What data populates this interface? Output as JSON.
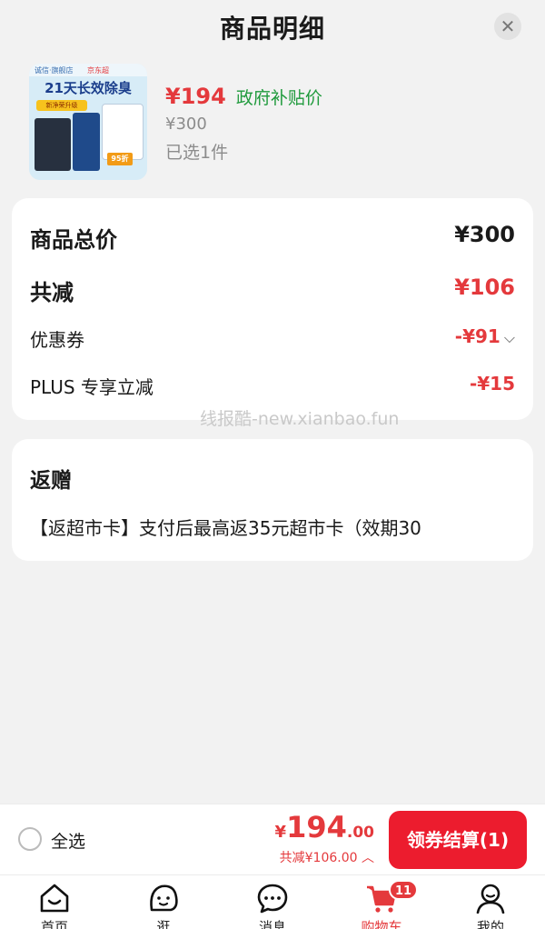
{
  "header": {
    "title": "商品明细",
    "close_icon": "close-icon"
  },
  "product": {
    "thumb": {
      "brand_left": "诚信·旗舰店",
      "brand_right": "京东超",
      "headline": "21天长效除臭",
      "tag": "新净荣升级",
      "badge": "95折"
    },
    "price": "¥194",
    "price_tag": "政府补贴价",
    "original_price": "¥300",
    "selected_count": "已选1件"
  },
  "summary": {
    "total_label": "商品总价",
    "total_value": "¥300",
    "reduce_label": "共减",
    "reduce_value": "¥106",
    "coupon_label": "优惠券",
    "coupon_value": "-¥91",
    "plus_label": "PLUS 专享立减",
    "plus_value": "-¥15"
  },
  "watermark": "线报酷-new.xianbao.fun",
  "gift": {
    "title": "返赠",
    "text": "【返超市卡】支付后最高返35元超市卡（效期30"
  },
  "checkout": {
    "select_all": "全选",
    "currency": "¥",
    "total_int": "194",
    "total_dec": ".00",
    "reduce_text": "共减¥106.00",
    "pay_button": "领券结算(1)"
  },
  "tabbar": {
    "items": [
      {
        "label": "首页",
        "icon": "home-icon"
      },
      {
        "label": "逛",
        "icon": "explore-icon"
      },
      {
        "label": "消息",
        "icon": "message-icon"
      },
      {
        "label": "购物车",
        "icon": "cart-icon",
        "badge": "11",
        "active": true
      },
      {
        "label": "我的",
        "icon": "profile-icon"
      }
    ]
  },
  "colors": {
    "accent": "#e4393c",
    "green": "#1f9a3c",
    "button": "#ec1c2e"
  }
}
